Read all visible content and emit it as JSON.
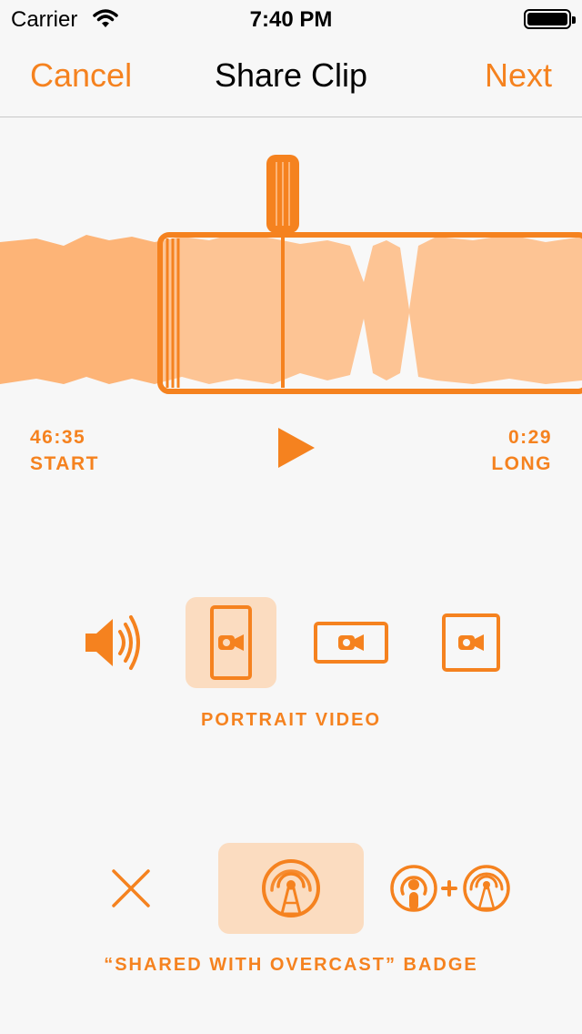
{
  "status_bar": {
    "carrier": "Carrier",
    "time": "7:40 PM"
  },
  "nav": {
    "cancel_label": "Cancel",
    "title": "Share Clip",
    "next_label": "Next"
  },
  "clip": {
    "start_time": "46:35",
    "start_label": "START",
    "length_time": "0:29",
    "length_label": "LONG"
  },
  "format": {
    "options": [
      "audio",
      "portrait-video",
      "landscape-video",
      "square-video"
    ],
    "selected": "portrait-video",
    "selected_label": "PORTRAIT VIDEO"
  },
  "badge": {
    "options": [
      "none",
      "overcast-badge",
      "podcasts-plus-overcast-badge"
    ],
    "selected": "overcast-badge",
    "selected_label": "“SHARED WITH OVERCAST” BADGE"
  },
  "colors": {
    "accent": "#f5821f",
    "waveform": "#fdb477",
    "selected_bg": "#fbdcc0",
    "background": "#f7f7f7"
  }
}
